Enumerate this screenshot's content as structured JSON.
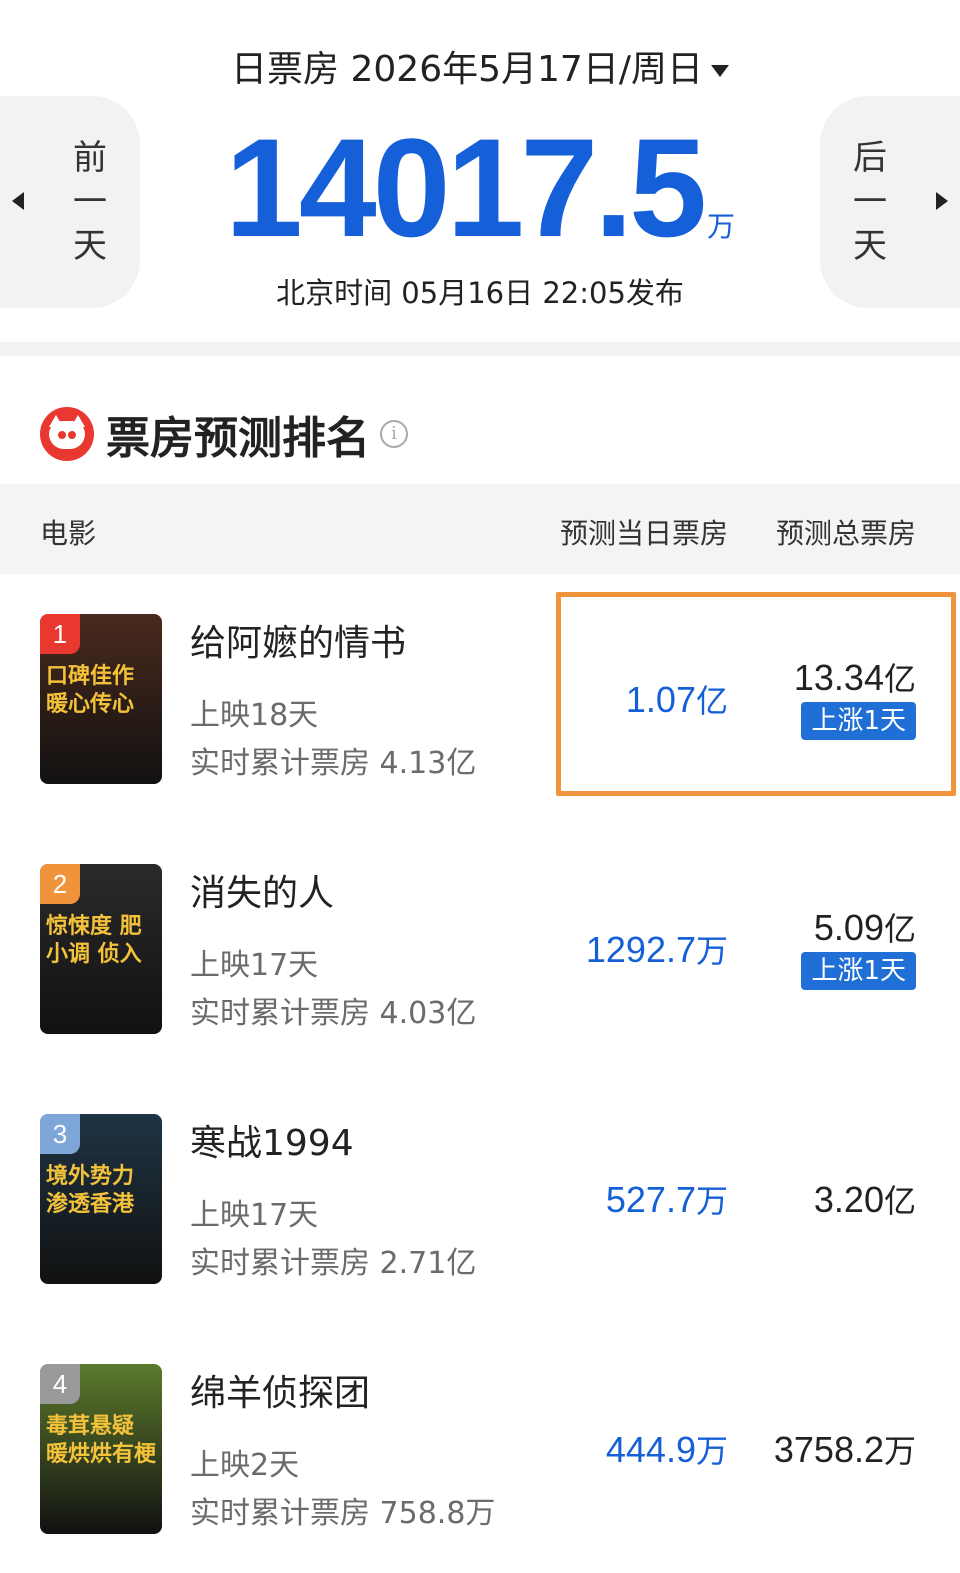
{
  "header": {
    "date_text": "日票房 2026年5月17日/周日",
    "total_value": "14017.5",
    "total_unit": "万",
    "publish_text": "北京时间  05月16日  22:05发布",
    "prev_day": [
      "前",
      "一",
      "天"
    ],
    "next_day": [
      "后",
      "一",
      "天"
    ]
  },
  "section": {
    "title": "票房预测排名",
    "info_glyph": "i"
  },
  "table_head": {
    "movie": "电影",
    "day_forecast": "预测当日票房",
    "total_forecast": "预测总票房"
  },
  "colors": {
    "accent_blue": "#1560d8",
    "highlight_orange": "#f0943c",
    "logo_red": "#e8382f"
  },
  "movies": [
    {
      "rank": "1",
      "rank_color": "#e8382f",
      "poster_text": "口碑佳作 暖心传心",
      "poster_bg": "#4a2a1e",
      "name": "给阿嬷的情书",
      "days": "上映18天",
      "cumulative": "实时累计票房 4.13亿",
      "day_value": "1.07",
      "day_unit": "亿",
      "total_value": "13.34",
      "total_unit": "亿",
      "badge": "上涨1天"
    },
    {
      "rank": "2",
      "rank_color": "#f0943c",
      "poster_text": "惊悚度 肥小调 侦入",
      "poster_bg": "#2a2a2a",
      "name": "消失的人",
      "days": "上映17天",
      "cumulative": "实时累计票房 4.03亿",
      "day_value": "1292.7",
      "day_unit": "万",
      "total_value": "5.09",
      "total_unit": "亿",
      "badge": "上涨1天"
    },
    {
      "rank": "3",
      "rank_color": "#7ea6d8",
      "poster_text": "境外势力 渗透香港",
      "poster_bg": "#1f3444",
      "name": "寒战1994",
      "days": "上映17天",
      "cumulative": "实时累计票房 2.71亿",
      "day_value": "527.7",
      "day_unit": "万",
      "total_value": "3.20",
      "total_unit": "亿",
      "badge": ""
    },
    {
      "rank": "4",
      "rank_color": "#9a9a9a",
      "poster_text": "毒茸悬疑 暖烘烘有梗",
      "poster_bg": "#5c7a2c",
      "name": "绵羊侦探团",
      "days": "上映2天",
      "cumulative": "实时累计票房 758.8万",
      "day_value": "444.9",
      "day_unit": "万",
      "total_value": "3758.2",
      "total_unit": "万",
      "badge": ""
    }
  ]
}
